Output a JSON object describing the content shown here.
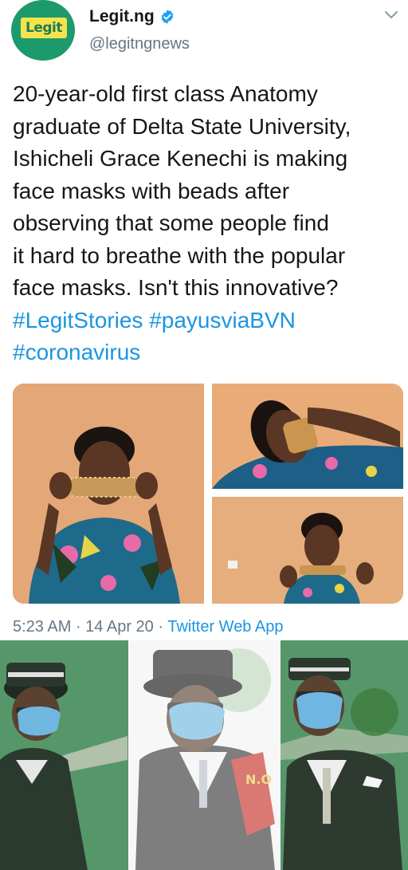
{
  "account": {
    "display_name": "Legit.ng",
    "handle": "@legitngnews",
    "avatar_text": "Legit",
    "verified": true
  },
  "tweet": {
    "lines": [
      "20-year-old first class Anatomy",
      "graduate of Delta State University,",
      "Ishicheli Grace Kenechi is making",
      "face masks with beads after",
      "observing that some people find",
      "it hard to breathe with the popular",
      "face masks. Isn't this innovative?"
    ],
    "hashtags_line1": "#LegitStories #payusviaBVN",
    "hashtags_line2": "#coronavirus"
  },
  "meta": {
    "time": "5:23 AM",
    "separator1": " · ",
    "date": "14 Apr 20",
    "separator2": " · ",
    "app": "Twitter Web App"
  },
  "colors": {
    "link": "#1b95e0",
    "verified": "#1da1f2",
    "secondary_text": "#657786",
    "brand_green": "#1d9a6c",
    "brand_yellow": "#f5e34b"
  },
  "icons": {
    "verified": "verified-badge-icon",
    "caret": "chevron-down-icon"
  }
}
